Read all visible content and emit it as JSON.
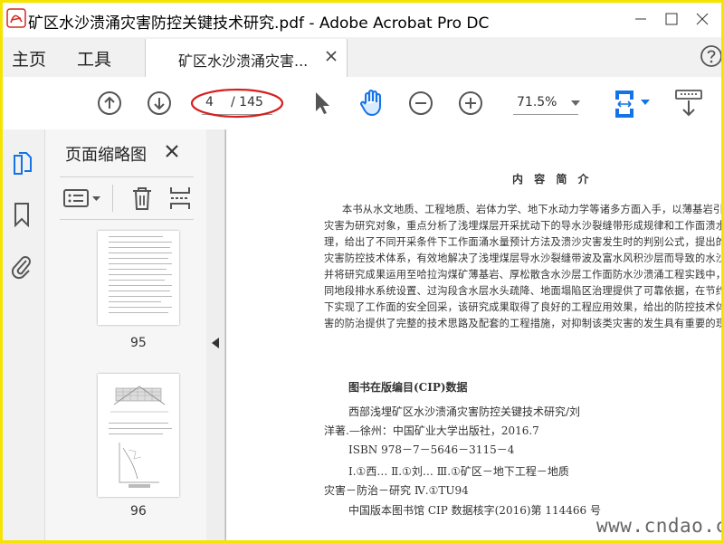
{
  "window": {
    "title": "矿区水沙溃涌灾害防控关键技术研究.pdf - Adobe Acrobat Pro DC"
  },
  "menu": {
    "home": "主页",
    "tools": "工具"
  },
  "tab": {
    "label": "矿区水沙溃涌灾害..."
  },
  "toolbar": {
    "page_current": "4",
    "page_total": "/ 145",
    "zoom": "71.5%"
  },
  "thumbnails": {
    "title": "页面缩略图",
    "pages": [
      {
        "number": "95"
      },
      {
        "number": "96"
      }
    ]
  },
  "document": {
    "heading": "内 容 简 介",
    "paragraph": [
      "本书从水文地质、工程地质、岩体力学、地下水动力学等诸多方面入手，以薄基岩引发的水",
      "灾害为研究对象，重点分析了浅埋煤层开采扰动下的导水沙裂缝带形成规律和工作面溃水、",
      "理，给出了不同开采条件下工作面涌水量预计方法及溃沙灾害发生时的判别公式，提出的溃水",
      "灾害防控技术体系，有效地解决了浅埋煤层导水沙裂缝带波及富水风积沙层而导致的水沙溃涌",
      "并将研究成果运用至哈拉沟煤矿薄基岩、厚松散含水沙层工作面防水沙溃涌工程实践中，为工",
      "同地段排水系统设置、过沟段含水层水头疏降、地面塌陷区治理提供了可靠依据，在节约资金",
      "下实现了工作面的安全回采，该研究成果取得了良好的工程应用效果，给出的防控技术体系为",
      "害的防治提供了完整的技术思路及配套的工程措施，对抑制该类灾害的发生具有重要的现实意"
    ],
    "cip": {
      "title": "图书在版编目(CIP)数据",
      "lines": [
        "西部浅埋矿区水沙溃涌灾害防控关键技术研究/刘",
        "洋著.—徐州：中国矿业大学出版社，2016.7",
        "ISBN 978－7－5646－3115－4",
        "Ⅰ.①西…  Ⅱ.①刘…  Ⅲ.①矿区－地下工程－地质",
        "灾害－防治－研究  Ⅳ.①TU94",
        "中国版本图书馆 CIP 数据核字(2016)第 114466 号"
      ]
    }
  },
  "watermark": "www.cndao.com",
  "colors": {
    "frame": "#f5e400",
    "accent": "#1473e6",
    "annotation": "#d62020"
  }
}
